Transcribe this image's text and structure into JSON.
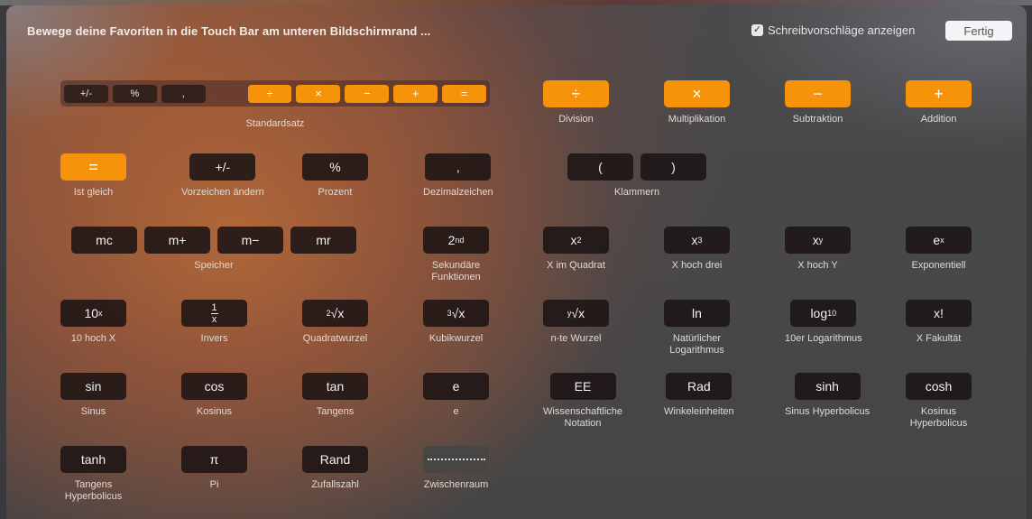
{
  "header": {
    "instruction": "Bewege deine Favoriten in die Touch Bar am unteren Bildschirmrand ...",
    "checkbox_label": "Schreibvorschläge anzeigen",
    "checkbox_checked": true,
    "done_label": "Fertig"
  },
  "colors": {
    "accent": "#f7930b",
    "key_dark": "#1c1414",
    "background_gray": "#464646"
  },
  "standard_set": {
    "label": "Standardsatz",
    "keys": [
      "+/-",
      "%",
      ",",
      "÷",
      "×",
      "−",
      "+",
      "="
    ]
  },
  "items": {
    "division": {
      "key": "÷",
      "label": "Division"
    },
    "multiplication": {
      "key": "×",
      "label": "Multiplikation"
    },
    "subtraction": {
      "key": "−",
      "label": "Subtraktion"
    },
    "addition": {
      "key": "+",
      "label": "Addition"
    },
    "equals": {
      "key": "=",
      "label": "Ist gleich"
    },
    "sign": {
      "key": "+/-",
      "label": "Vorzeichen ändern"
    },
    "percent": {
      "key": "%",
      "label": "Prozent"
    },
    "decimal": {
      "key": ",",
      "label": "Dezimalzeichen"
    },
    "brackets": {
      "keys": [
        "(",
        ")"
      ],
      "label": "Klammern"
    },
    "memory": {
      "keys": [
        "mc",
        "m+",
        "m−",
        "mr"
      ],
      "label": "Speicher"
    },
    "second": {
      "key_base": "2",
      "key_sup": "nd",
      "label_line1": "Sekundäre",
      "label_line2": "Funktionen"
    },
    "x_squared": {
      "key_base": "x",
      "key_sup": "2",
      "label": "X im Quadrat"
    },
    "x_cubed": {
      "key_base": "x",
      "key_sup": "3",
      "label": "X hoch drei"
    },
    "x_pow_y": {
      "key_base": "x",
      "key_sup": "y",
      "label": "X hoch Y"
    },
    "exp": {
      "key_base": "e",
      "key_sup": "x",
      "label": "Exponentiell"
    },
    "ten_pow_x": {
      "key_base": "10",
      "key_sup": "x",
      "label": "10 hoch X"
    },
    "inverse": {
      "num": "1",
      "den": "x",
      "label": "Invers"
    },
    "sqrt": {
      "root_index": "2",
      "radical": "√x",
      "label": "Quadratwurzel"
    },
    "cbrt": {
      "root_index": "3",
      "radical": "√x",
      "label": "Kubikwurzel"
    },
    "nth_root": {
      "root_index": "y",
      "radical": "√x",
      "label": "n-te Wurzel"
    },
    "ln": {
      "key": "ln",
      "label_line1": "Natürlicher",
      "label_line2": "Logarithmus"
    },
    "log10": {
      "key_base": "log",
      "key_sub": "10",
      "label": "10er Logarithmus"
    },
    "factorial": {
      "key": "x!",
      "label": "X Fakultät"
    },
    "sin": {
      "key": "sin",
      "label": "Sinus"
    },
    "cos": {
      "key": "cos",
      "label": "Kosinus"
    },
    "tan": {
      "key": "tan",
      "label": "Tangens"
    },
    "e": {
      "key": "e",
      "label": "e"
    },
    "ee": {
      "key": "EE",
      "label_line1": "Wissenschaftliche",
      "label_line2": "Notation"
    },
    "rad": {
      "key": "Rad",
      "label": "Winkeleinheiten"
    },
    "sinh": {
      "key": "sinh",
      "label": "Sinus Hyperbolicus"
    },
    "cosh": {
      "key": "cosh",
      "label_line1": "Kosinus",
      "label_line2": "Hyperbolicus"
    },
    "tanh": {
      "key": "tanh",
      "label_line1": "Tangens",
      "label_line2": "Hyperbolicus"
    },
    "pi": {
      "key": "π",
      "label": "Pi"
    },
    "rand": {
      "key": "Rand",
      "label": "Zufallszahl"
    },
    "space": {
      "label": "Zwischenraum"
    }
  }
}
